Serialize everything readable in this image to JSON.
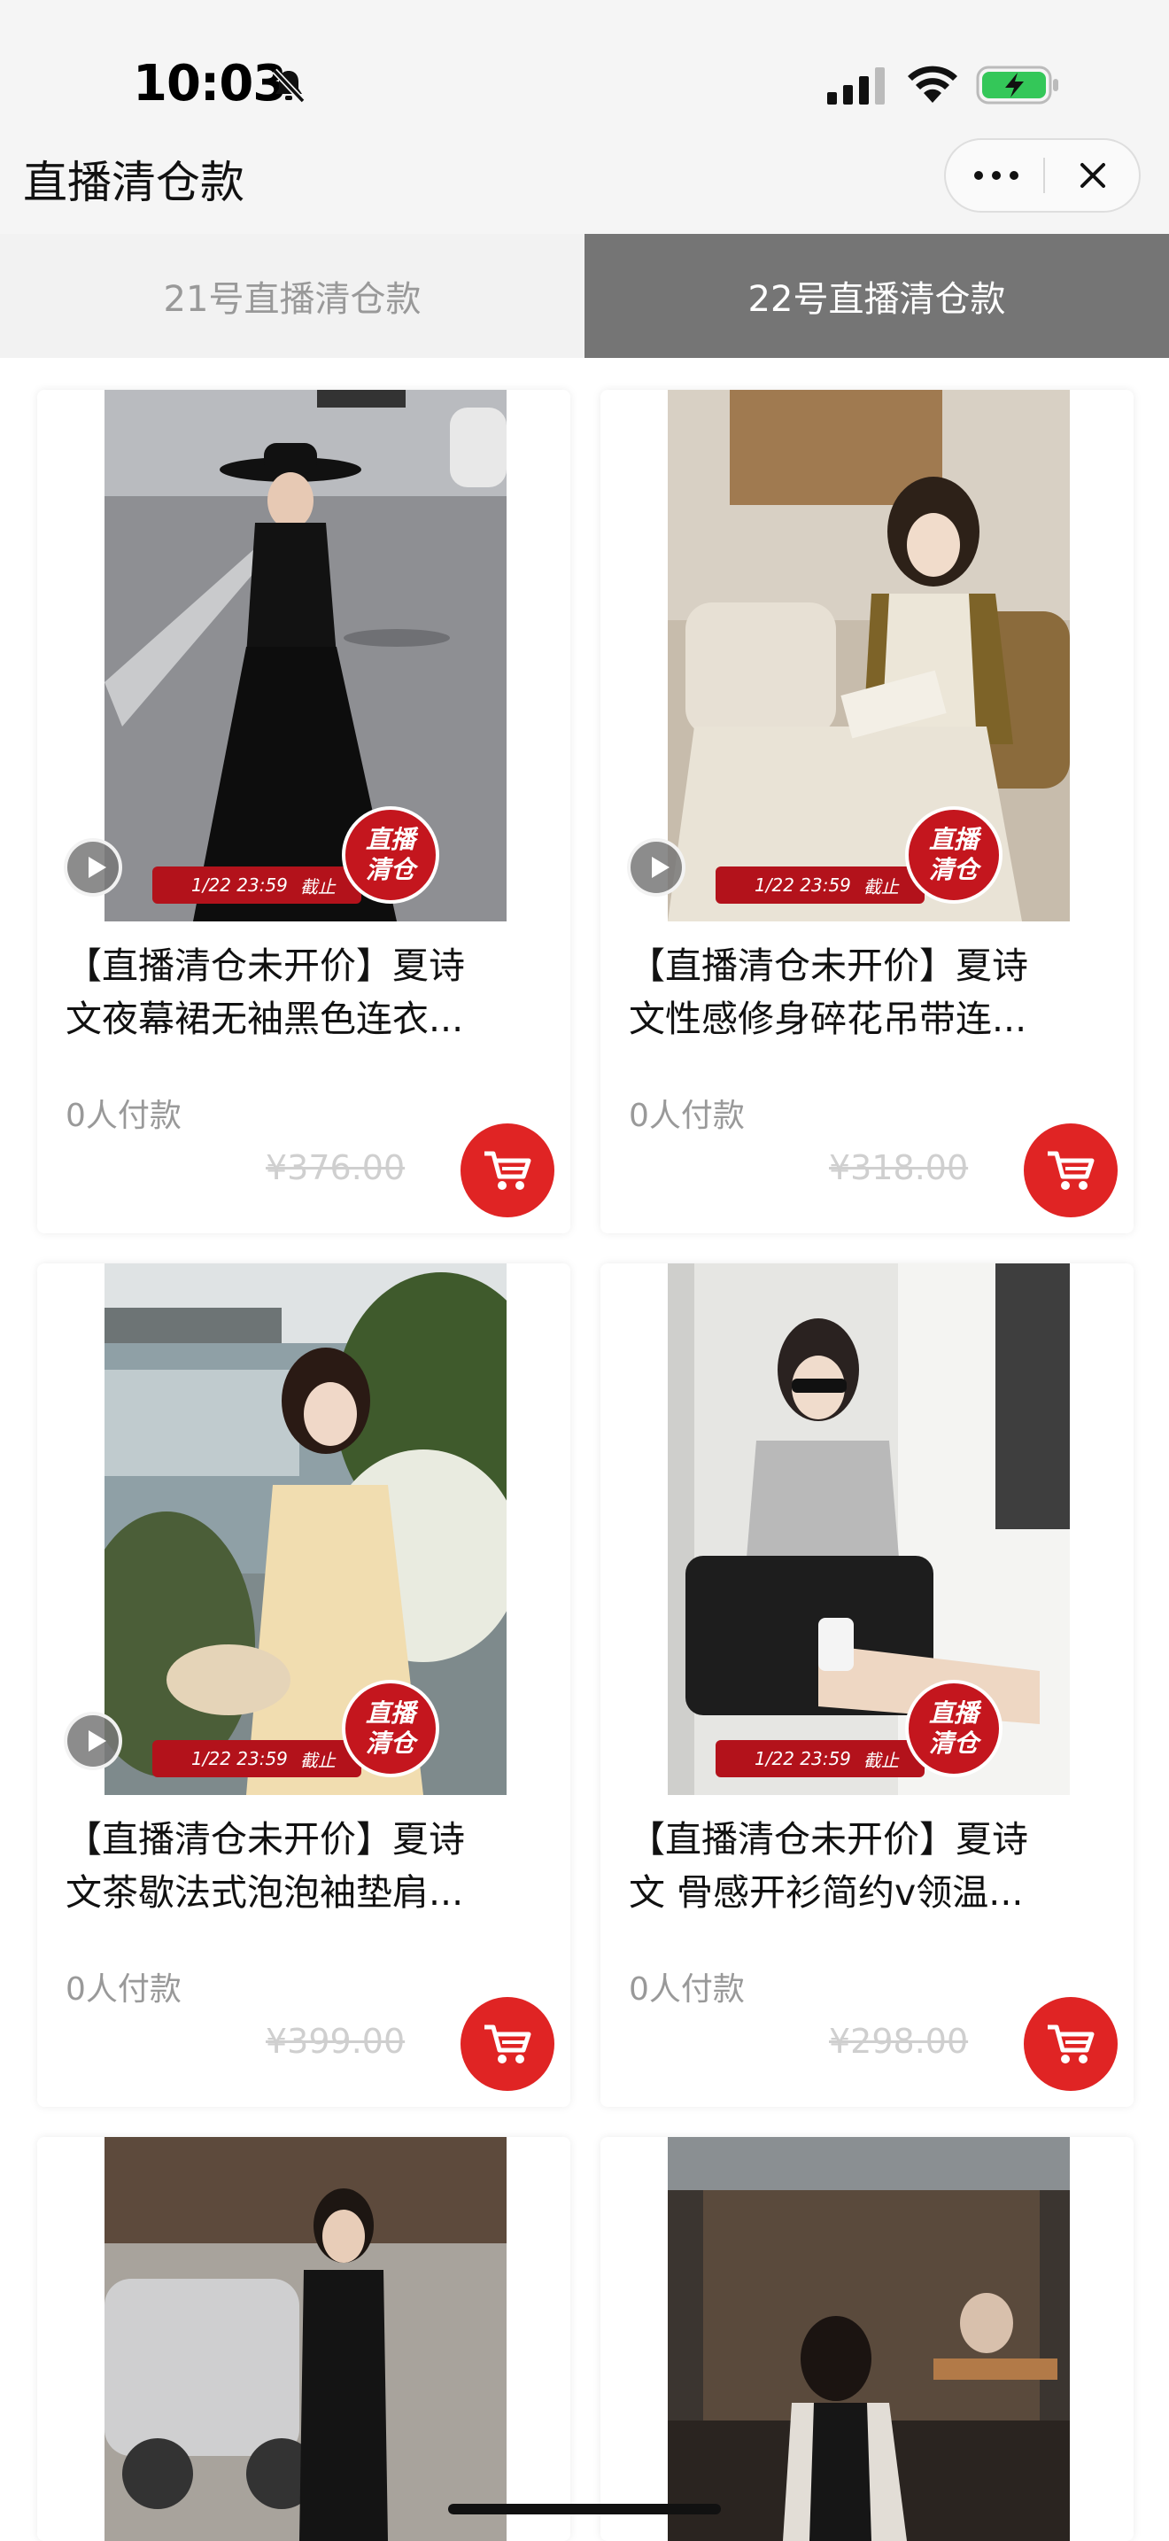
{
  "status_bar": {
    "time": "10:03"
  },
  "nav": {
    "title": "直播清仓款"
  },
  "tabs": [
    {
      "label": "21号直播清仓款",
      "active": false
    },
    {
      "label": "22号直播清仓款",
      "active": true
    }
  ],
  "promo": {
    "date_text": "1/22 23:59",
    "deadline_text": "截止",
    "badge_line1": "直播",
    "badge_line2": "清仓"
  },
  "products": [
    {
      "title_line1": "【直播清仓未开价】夏诗",
      "title_line2": "文夜幕裙无袖黑色连衣...",
      "sales": "0人付款",
      "price": "¥376.00"
    },
    {
      "title_line1": "【直播清仓未开价】夏诗",
      "title_line2": "文性感修身碎花吊带连...",
      "sales": "0人付款",
      "price": "¥318.00"
    },
    {
      "title_line1": "【直播清仓未开价】夏诗",
      "title_line2": "文茶歇法式泡泡袖垫肩...",
      "sales": "0人付款",
      "price": "¥399.00"
    },
    {
      "title_line1": "【直播清仓未开价】夏诗",
      "title_line2": "文 骨感开衫简约v领温...",
      "sales": "0人付款",
      "price": "¥298.00"
    }
  ],
  "colors": {
    "accent_red": "#e02424",
    "tab_active_bg": "#757575"
  },
  "icons": [
    "bell-slash-icon",
    "signal-icon",
    "wifi-icon",
    "battery-charging-icon",
    "more-icon",
    "close-icon",
    "play-icon",
    "cart-icon"
  ]
}
